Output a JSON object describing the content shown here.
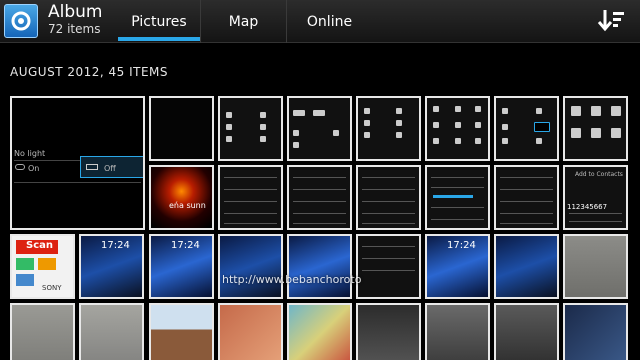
{
  "header": {
    "title": "Album",
    "subtitle": "72 items",
    "tabs": [
      {
        "label": "Pictures",
        "active": true
      },
      {
        "label": "Map",
        "active": false
      },
      {
        "label": "Online",
        "active": false
      }
    ],
    "icons": {
      "album": "album-icon",
      "sort": "sort-icon"
    }
  },
  "section": {
    "title": "AUGUST 2012, 45 ITEMS"
  },
  "thumbnails": {
    "no_light_label": "No light",
    "on_label": "On",
    "off_label": "Off",
    "candle_text": "eńa sunn",
    "scan_label": "Scan",
    "sony_label": "SONY",
    "time_a": "17:24",
    "time_b": "17:24",
    "time_c": "17:24",
    "pin_digits": "112345667",
    "add_contacts": "Add to Contacts",
    "url_watermark": "http://www.bebanchoroto"
  },
  "colors": {
    "accent": "#2aa7e8",
    "header_bg": "#1f1f1f",
    "page_bg": "#000000"
  }
}
